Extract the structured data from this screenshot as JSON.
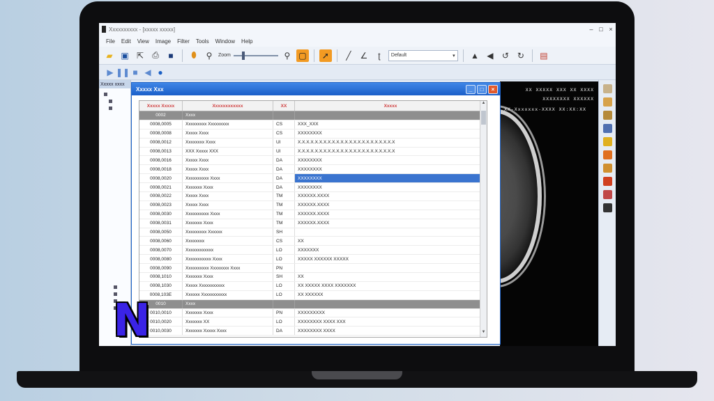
{
  "window": {
    "title": "Xxxxxxxxxx - [xxxxx xxxxx]"
  },
  "menu": [
    "File",
    "Edit",
    "View",
    "Image",
    "Filter",
    "Tools",
    "Window",
    "Help"
  ],
  "toolbar": {
    "zoom_label": "Zoom",
    "combo_value": "Default",
    "icons": [
      "open-folder-icon",
      "save-icon",
      "cursor-icon",
      "print-icon",
      "floppy-icon",
      "pin-icon",
      "magnifier-icon",
      "zoom-in-icon",
      "crop-icon",
      "select-icon",
      "line-icon",
      "angle-icon",
      "text-icon",
      "triangle-icon",
      "flip-icon",
      "rotate-left-icon",
      "rotate-right-icon",
      "window-icon"
    ]
  },
  "toolbar2": {
    "icons": [
      "play-icon",
      "pause-icon",
      "stop-icon",
      "rewind-icon",
      "record-icon"
    ]
  },
  "sidepanel": {
    "header": "Xxxxx xxxx"
  },
  "dialog": {
    "title": "Xxxxx Xxx",
    "columns": [
      "Xxxxx Xxxxx",
      "Xxxxxxxxxxxx",
      "XX",
      "Xxxxx"
    ],
    "rows": [
      {
        "type": "group",
        "tag": "0002",
        "desc": "Xxxx",
        "vr": "",
        "value": ""
      },
      {
        "tag": "0008,0005",
        "desc": "Xxxxxxxxx Xxxxxxxxx",
        "vr": "CS",
        "value": "XXX_XXX"
      },
      {
        "tag": "0008,0008",
        "desc": "Xxxxx Xxxx",
        "vr": "CS",
        "value": "XXXXXXXX"
      },
      {
        "tag": "0008,0012",
        "desc": "Xxxxxxxx Xxxx",
        "vr": "UI",
        "value": "X.X.X.X.X.X.X.X.X.X.X.X.X.X.X.X.X.X.X.X.X.X.X"
      },
      {
        "tag": "0008,0013",
        "desc": "XXX Xxxxx XXX",
        "vr": "UI",
        "value": "X.X.X.X.X.X.X.X.X.X.X.X.X.X.X.X.X.X.X.X.X.X.X"
      },
      {
        "tag": "0008,0016",
        "desc": "Xxxxx Xxxx",
        "vr": "DA",
        "value": "XXXXXXXX"
      },
      {
        "tag": "0008,0018",
        "desc": "Xxxxx Xxxx",
        "vr": "DA",
        "value": "XXXXXXXX"
      },
      {
        "tag": "0008,0020",
        "desc": "Xxxxxxxxxx Xxxx",
        "vr": "DA",
        "value": "XXXXXXXX",
        "selected": true
      },
      {
        "tag": "0008,0021",
        "desc": "Xxxxxxx Xxxx",
        "vr": "DA",
        "value": "XXXXXXXX"
      },
      {
        "tag": "0008,0022",
        "desc": "Xxxxx Xxxx",
        "vr": "TM",
        "value": "XXXXXX.XXXX"
      },
      {
        "tag": "0008,0023",
        "desc": "Xxxxx Xxxx",
        "vr": "TM",
        "value": "XXXXXX.XXXX"
      },
      {
        "tag": "0008,0030",
        "desc": "Xxxxxxxxxx Xxxx",
        "vr": "TM",
        "value": "XXXXXX.XXXX"
      },
      {
        "tag": "0008,0031",
        "desc": "Xxxxxxx Xxxx",
        "vr": "TM",
        "value": "XXXXXX.XXXX"
      },
      {
        "tag": "0008,0050",
        "desc": "Xxxxxxxxx Xxxxxx",
        "vr": "SH",
        "value": ""
      },
      {
        "tag": "0008,0060",
        "desc": "Xxxxxxxx",
        "vr": "CS",
        "value": "XX"
      },
      {
        "tag": "0008,0070",
        "desc": "Xxxxxxxxxxxx",
        "vr": "LO",
        "value": "XXXXXXX"
      },
      {
        "tag": "0008,0080",
        "desc": "Xxxxxxxxxxx Xxxx",
        "vr": "LO",
        "value": "XXXXX XXXXXX XXXXX"
      },
      {
        "tag": "0008,0090",
        "desc": "Xxxxxxxxxx Xxxxxxxx Xxxx",
        "vr": "PN",
        "value": ""
      },
      {
        "tag": "0008,1010",
        "desc": "Xxxxxxx Xxxx",
        "vr": "SH",
        "value": "XX"
      },
      {
        "tag": "0008,1030",
        "desc": "Xxxxx Xxxxxxxxxxx",
        "vr": "LO",
        "value": "XX XXXXX XXXX XXXXXXX"
      },
      {
        "tag": "0008,103E",
        "desc": "Xxxxxx Xxxxxxxxxxx",
        "vr": "LO",
        "value": "XX XXXXXX"
      },
      {
        "type": "group",
        "tag": "0010",
        "desc": "Xxxx",
        "vr": "",
        "value": ""
      },
      {
        "tag": "0010,0010",
        "desc": "Xxxxxxx Xxxx",
        "vr": "PN",
        "value": "XXXXXXXXX"
      },
      {
        "tag": "0010,0020",
        "desc": "Xxxxxxx XX",
        "vr": "LO",
        "value": "XXXXXXXX XXXX XXX"
      },
      {
        "tag": "0010,0030",
        "desc": "Xxxxxxx Xxxxx Xxxx",
        "vr": "DA",
        "value": "XXXXXXXX XXXX"
      }
    ]
  },
  "viewer": {
    "overlay_right": [
      "XX XXXXX XXX XX XXXX",
      "XXXXXXXX XXXXXX"
    ],
    "overlay_left": "XX-Xxxxxxx-XXXX XX:XX:XX"
  },
  "colors": {
    "accent": "#1b5fc9",
    "selection": "#3a74cf",
    "header_text": "#d04040",
    "logo": "#3a23e6"
  },
  "logo_text": "N"
}
